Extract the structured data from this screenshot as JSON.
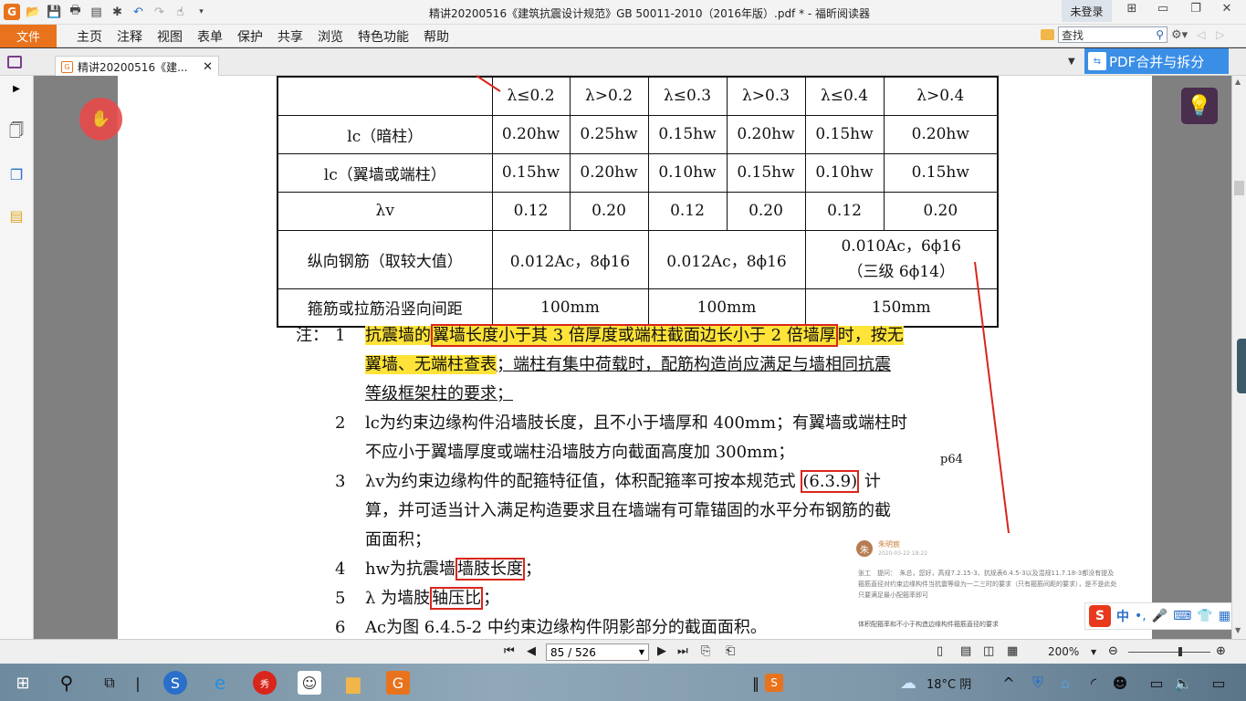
{
  "window": {
    "title": "精讲20200516《建筑抗震设计规范》GB 50011-2010（2016年版）.pdf * - 福昕阅读器",
    "login_label": "未登录"
  },
  "menu": {
    "file": "文件",
    "items": [
      "主页",
      "注释",
      "视图",
      "表单",
      "保护",
      "共享",
      "浏览",
      "特色功能",
      "帮助"
    ],
    "search_placeholder": "查找"
  },
  "tab": {
    "doc_title": "精讲20200516《建...",
    "merge_label": "PDF合并与拆分"
  },
  "table": {
    "header_row": [
      "λ≤0.2",
      "λ>0.2",
      "λ≤0.3",
      "λ>0.3",
      "λ≤0.4",
      "λ>0.4"
    ],
    "rows": [
      {
        "label": "lc（暗柱）",
        "cells": [
          "0.20hw",
          "0.25hw",
          "0.15hw",
          "0.20hw",
          "0.15hw",
          "0.20hw"
        ]
      },
      {
        "label": "lc（翼墙或端柱）",
        "cells": [
          "0.15hw",
          "0.20hw",
          "0.10hw",
          "0.15hw",
          "0.10hw",
          "0.15hw"
        ]
      },
      {
        "label": "λv",
        "cells": [
          "0.12",
          "0.20",
          "0.12",
          "0.20",
          "0.12",
          "0.20"
        ]
      }
    ],
    "rebar_label": "纵向钢筋（取较大值）",
    "rebar_cells": [
      "0.012Ac，8ϕ16",
      "0.012Ac，8ϕ16"
    ],
    "rebar_cell3_line1": "0.010Ac，6ϕ16",
    "rebar_cell3_line2": "（三级 6ϕ14）",
    "stirrup_label": "箍筋或拉筋沿竖向间距",
    "stirrup_cells": [
      "100mm",
      "100mm",
      "150mm"
    ]
  },
  "notes": {
    "prefix": "注：",
    "n1": "1",
    "n1_a": "抗震墙的",
    "n1_b": "翼墙长度小于其 3 倍厚度或端柱截面边长小于 2 倍墙厚",
    "n1_c": "时，按无",
    "n1_d": "翼墙、无端柱查表",
    "n1_e": "；端柱有集中荷载时，配筋构造尚应满足与墙相同抗震",
    "n1_f": "等级框架柱的要求；",
    "n2": "2",
    "n2_a": "lc为约束边缘构件沿墙肢长度，且不小于墙厚和 400mm；有翼墙或端柱时",
    "n2_b": "不应小于翼墙厚度或端柱沿墙肢方向截面高度加 300mm；",
    "n3": "3",
    "n3_a": "λv为约束边缘构件的配箍特征值，体积配箍率可按本规范式",
    "n3_formula": "(6.3.9)",
    "n3_b": "计",
    "n3_c": "算，并可适当计入满足构造要求且在墙端有可靠锚固的水平分布钢筋的截",
    "n3_d": "面面积；",
    "p64": "p64",
    "n4": "4",
    "n4_a": "hw为抗震墙",
    "n4_b": "墙肢长度",
    "n4_c": "；",
    "n5": "5",
    "n5_a": "λ 为墙肢",
    "n5_b": "轴压比",
    "n5_c": "；",
    "n6": "6",
    "n6_a": "Ac为图 6.4.5-2 中约束边缘构件阴影部分的截面面积。"
  },
  "comment": {
    "avatar": "朱",
    "name": "朱明宸",
    "date": "2020-03-22 18:22",
    "body": "张工　提问：　朱总，您好，高规7.2.15-3、抗规表6.4.5-3以及混规11.7.18-3都没有提及箍筋直径对约束边缘构件当抗震等级为一二三时的要求（只有箍筋间距的要求），是不是此处只要满足最小配箍率即可",
    "footer": "体积配箍率和不小于构造边缘构件箍筋直径的要求"
  },
  "ime": {
    "logo": "S",
    "label": "中"
  },
  "status": {
    "page_value": "85 / 526",
    "zoom": "200%"
  },
  "taskbar": {
    "weather": "18°C 阴",
    "sogou_icon": "S"
  }
}
